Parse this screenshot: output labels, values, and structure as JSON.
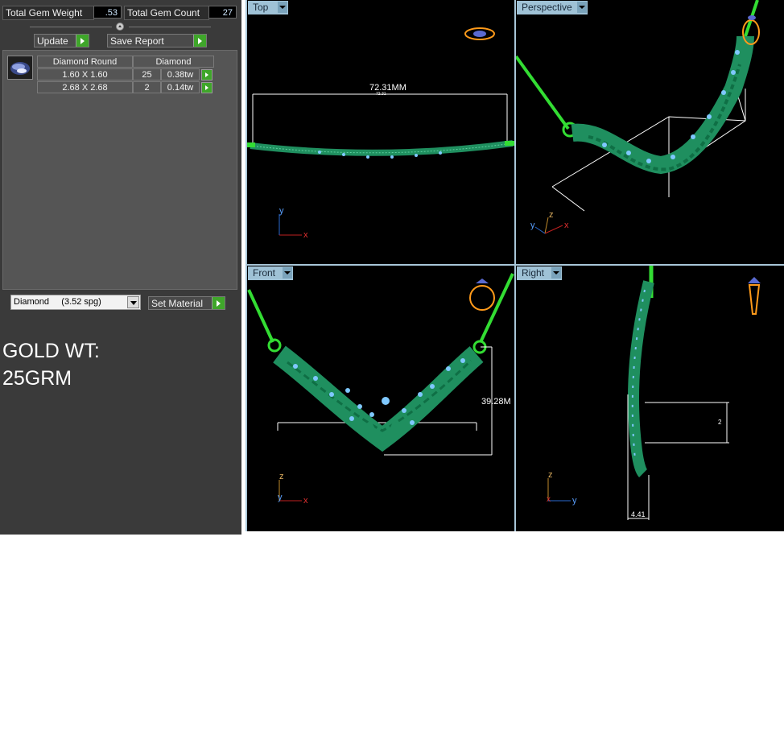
{
  "stats": {
    "total_gem_weight_label": "Total Gem Weight",
    "total_gem_weight_value": ".53",
    "total_gem_count_label": "Total Gem Count",
    "total_gem_count_value": "27"
  },
  "toolbar": {
    "update_label": "Update",
    "save_report_label": "Save Report"
  },
  "gem_table": {
    "headers": [
      "Diamond Round",
      "Diamond"
    ],
    "rows": [
      {
        "size": "1.60 X 1.60",
        "count": "25",
        "weight": "0.38tw"
      },
      {
        "size": "2.68 X 2.68",
        "count": "2",
        "weight": "0.14tw"
      }
    ]
  },
  "material": {
    "selected": "Diamond     (3.52 spg)",
    "set_label": "Set Material"
  },
  "gold": {
    "line1": "GOLD WT:",
    "line2": "25GRM"
  },
  "viewports": {
    "top": {
      "label": "Top",
      "dimension": "72.31MM",
      "dimension_small": "72.31"
    },
    "perspective": {
      "label": "Perspective"
    },
    "front": {
      "label": "Front",
      "dimension": "39.28M"
    },
    "right": {
      "label": "Right",
      "dimension": "4.41",
      "dimension_side": "2"
    }
  },
  "axes": {
    "x": "x",
    "y": "y",
    "z": "z"
  },
  "colors": {
    "model_green": "#1f8f5f",
    "wire_green": "#33dd33",
    "gem_blue": "#7fc8ff",
    "gold_orange": "#ff9a1a",
    "viewport_tab": "#9fc2d6"
  }
}
